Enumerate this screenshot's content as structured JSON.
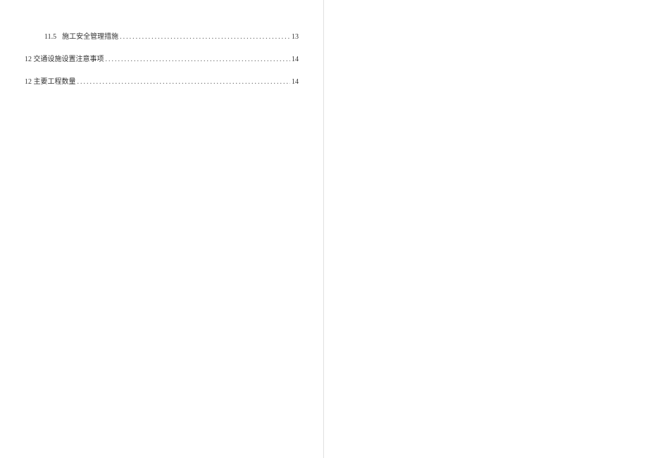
{
  "toc": {
    "entries": [
      {
        "num": "11.5",
        "title": "施工安全管理措施",
        "page": "13",
        "indent": true
      },
      {
        "num": "12",
        "title": "交通设施设置注意事项",
        "page": "14",
        "indent": false
      },
      {
        "num": "12",
        "title": "主要工程数量",
        "page": "14",
        "indent": false
      }
    ]
  }
}
